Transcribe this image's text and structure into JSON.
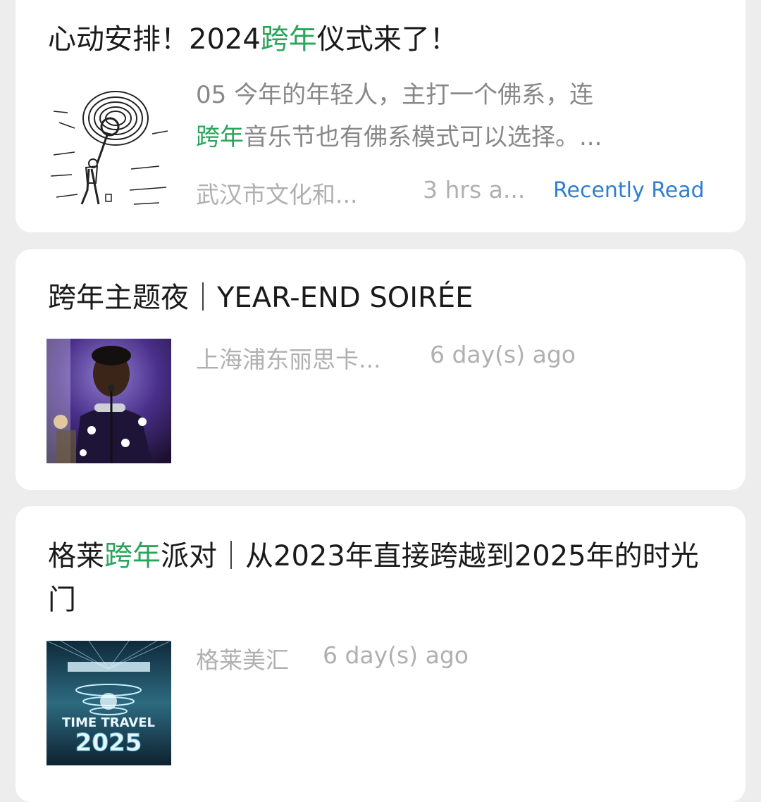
{
  "articles": [
    {
      "title": {
        "pre": "心动安排！2024",
        "hl": "跨年",
        "post": "仪式来了！"
      },
      "summary": {
        "line1": "05 今年的年轻人，主打一个佛系，连",
        "hl": "跨年",
        "line2": "音乐节也有佛系模式可以选择。..."
      },
      "source": "武汉市文化和...",
      "time": "3 hrs a...",
      "badge": "Recently Read",
      "thumb_icon": "sketch-illustration"
    },
    {
      "title": {
        "text": "跨年主题夜｜YEAR-END SOIRÉE"
      },
      "source": "上海浦东丽思卡...",
      "time": "6 day(s) ago",
      "thumb_icon": "singer-photo"
    },
    {
      "title": {
        "pre": "格莱",
        "hl": "跨年",
        "post": "派对｜从2023年直接跨越到2025年的时光门"
      },
      "source": "格莱美汇",
      "time": "6 day(s) ago",
      "thumb_icon": "time-travel-poster",
      "thumb_text": {
        "line1": "TIME TRAVEL",
        "line2": "2025"
      }
    }
  ],
  "colors": {
    "highlight": "#2aa55b",
    "link": "#2f7fcf",
    "meta": "#b0b0b0"
  }
}
